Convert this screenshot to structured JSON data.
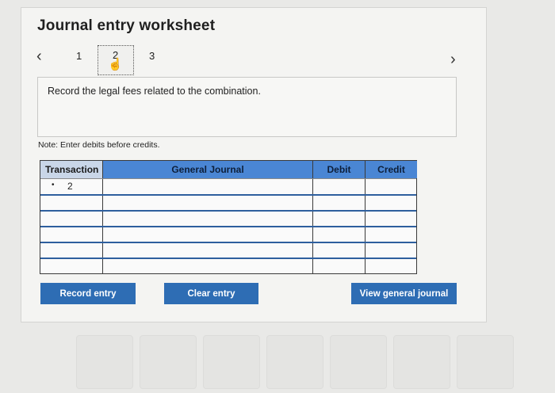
{
  "worksheet": {
    "title": "Journal entry worksheet",
    "steps": [
      "1",
      "2",
      "3"
    ],
    "current_step": "2",
    "prompt": "Record the legal fees related to the combination.",
    "note": "Note: Enter debits before credits."
  },
  "journal": {
    "headers": {
      "transaction": "Transaction",
      "general_journal": "General Journal",
      "debit": "Debit",
      "credit": "Credit"
    },
    "rows": [
      {
        "transaction": "2",
        "account": "",
        "debit": "",
        "credit": ""
      },
      {
        "transaction": "",
        "account": "",
        "debit": "",
        "credit": ""
      },
      {
        "transaction": "",
        "account": "",
        "debit": "",
        "credit": ""
      },
      {
        "transaction": "",
        "account": "",
        "debit": "",
        "credit": ""
      },
      {
        "transaction": "",
        "account": "",
        "debit": "",
        "credit": ""
      },
      {
        "transaction": "",
        "account": "",
        "debit": "",
        "credit": ""
      }
    ]
  },
  "buttons": {
    "record": "Record entry",
    "clear": "Clear entry",
    "view": "View general journal"
  },
  "icons": {
    "prev": "chevron-left-icon",
    "next": "chevron-right-icon",
    "hand": "hand-pointer-icon"
  },
  "colors": {
    "header_blue": "#4a86d4",
    "button_blue": "#2e6db4"
  }
}
